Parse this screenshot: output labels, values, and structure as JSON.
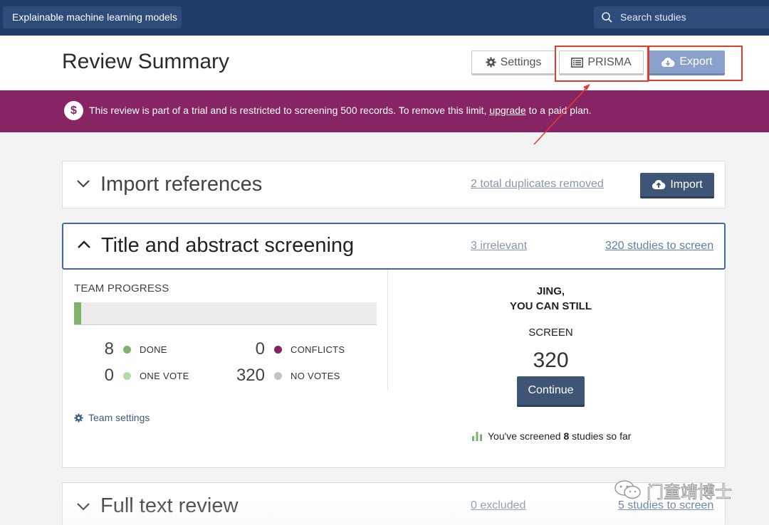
{
  "topbar": {
    "project_name": "Explainable machine learning models",
    "search_placeholder": "Search studies"
  },
  "header": {
    "title": "Review Summary",
    "settings_label": "Settings",
    "prisma_label": "PRISMA",
    "export_label": "Export"
  },
  "banner": {
    "icon": "$",
    "text_before": "This review is part of a trial and is restricted to screening 500 records. To remove this limit,",
    "link": "upgrade",
    "text_after": "to a paid plan."
  },
  "import_section": {
    "title": "Import references",
    "duplicates_link": "2 total duplicates removed",
    "import_button": "Import"
  },
  "screening_section": {
    "title": "Title and abstract screening",
    "irrelevant_link": "3 irrelevant",
    "to_screen_link": "320 studies to screen",
    "team_progress_label": "TEAM PROGRESS",
    "progress_fraction": 0.024,
    "stats": [
      {
        "value": "8",
        "label": "DONE",
        "color": "#7fb26f"
      },
      {
        "value": "0",
        "label": "CONFLICTS",
        "color": "#862464"
      },
      {
        "value": "0",
        "label": "ONE VOTE",
        "color": "#b4dca4"
      },
      {
        "value": "320",
        "label": "NO VOTES",
        "color": "#c4c4c4"
      }
    ],
    "team_settings": "Team settings",
    "you_name_line1": "JING,",
    "you_name_line2": "YOU CAN STILL",
    "you_screen": "SCREEN",
    "you_count": "320",
    "continue_button": "Continue",
    "screened_before": "You've screened",
    "screened_count": "8",
    "screened_after": "studies so far"
  },
  "full_text_section": {
    "title": "Full text review",
    "excluded_link": "0 excluded",
    "to_screen_link": "5 studies to screen"
  },
  "watermark": {
    "text": "门童靖博士"
  },
  "colors": {
    "topbar": "#1f3b67",
    "banner": "#862464",
    "primary_button": "#3f5576",
    "export_button": "#8aa1cc",
    "annotation_red": "#e53b2c"
  }
}
